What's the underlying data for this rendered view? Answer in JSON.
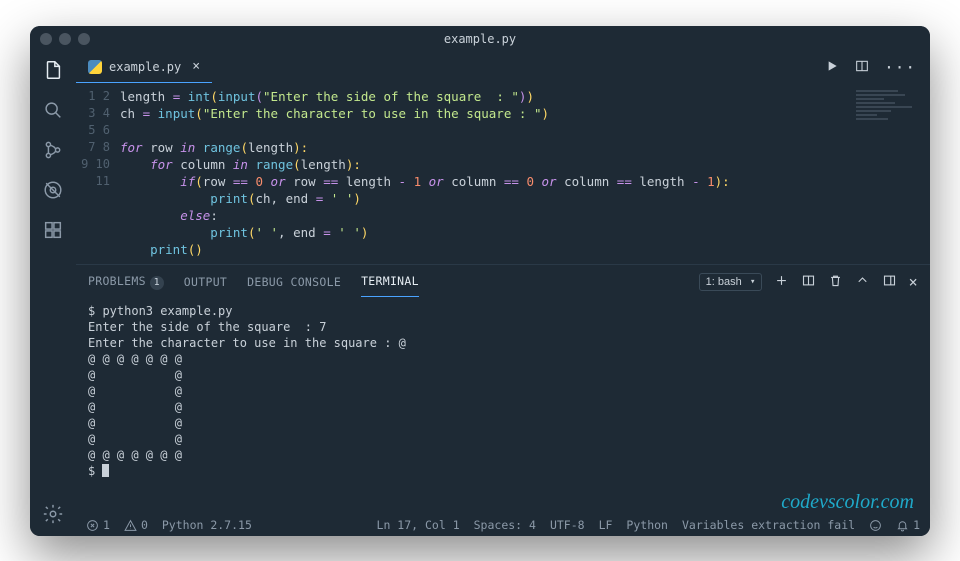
{
  "window": {
    "title": "example.py"
  },
  "tabs": [
    {
      "label": "example.py"
    }
  ],
  "code": {
    "line_numbers": [
      "1",
      "2",
      "3",
      "4",
      "5",
      "6",
      "7",
      "8",
      "9",
      "10",
      "11"
    ],
    "l1_a": "length ",
    "l1_b": "= ",
    "l1_c": "int",
    "l1_d": "(",
    "l1_e": "input",
    "l1_f": "(",
    "l1_g": "\"Enter the side of the square  : \"",
    "l1_h": ")",
    "l1_i": ")",
    "l2_a": "ch ",
    "l2_b": "= ",
    "l2_c": "input",
    "l2_d": "(",
    "l2_e": "\"Enter the character to use in the square : \"",
    "l2_f": ")",
    "l4_a": "for ",
    "l4_b": "row ",
    "l4_c": "in ",
    "l4_d": "range",
    "l4_e": "(",
    "l4_f": "length",
    "l4_g": "):",
    "l5_a": "    for ",
    "l5_b": "column ",
    "l5_c": "in ",
    "l5_d": "range",
    "l5_e": "(",
    "l5_f": "length",
    "l5_g": "):",
    "l6_a": "        if",
    "l6_b": "(",
    "l6_c": "row ",
    "l6_d": "== ",
    "l6_e": "0",
    "l6_f": " or ",
    "l6_g": "row ",
    "l6_h": "== ",
    "l6_i": "length ",
    "l6_j": "- ",
    "l6_k": "1",
    "l6_l": " or ",
    "l6_m": "column ",
    "l6_n": "== ",
    "l6_o": "0",
    "l6_p": " or ",
    "l6_q": "column ",
    "l6_r": "== ",
    "l6_s": "length ",
    "l6_t": "- ",
    "l6_u": "1",
    "l6_v": "):",
    "l7_a": "            print",
    "l7_b": "(",
    "l7_c": "ch",
    "l7_d": ", ",
    "l7_e": "end ",
    "l7_f": "= ",
    "l7_g": "' '",
    "l7_h": ")",
    "l8_a": "        else",
    "l8_b": ":",
    "l9_a": "            print",
    "l9_b": "(",
    "l9_c": "' '",
    "l9_d": ", ",
    "l9_e": "end ",
    "l9_f": "= ",
    "l9_g": "' '",
    "l9_h": ")",
    "l10_a": "    print",
    "l10_b": "()"
  },
  "panel": {
    "tabs": {
      "problems": "PROBLEMS",
      "problems_badge": "1",
      "output": "OUTPUT",
      "debug": "DEBUG CONSOLE",
      "terminal": "TERMINAL"
    },
    "terminal_selector": "1: bash"
  },
  "terminal": {
    "lines": [
      "$ python3 example.py",
      "Enter the side of the square  : 7",
      "Enter the character to use in the square : @",
      "@ @ @ @ @ @ @ ",
      "@           @ ",
      "@           @ ",
      "@           @ ",
      "@           @ ",
      "@           @ ",
      "@ @ @ @ @ @ @ ",
      "$ "
    ]
  },
  "watermark": "codevscolor.com",
  "statusbar": {
    "errors": "1",
    "warnings": "0",
    "python": "Python 2.7.15",
    "position": "Ln 17, Col 1",
    "spaces": "Spaces: 4",
    "encoding": "UTF-8",
    "eol": "LF",
    "language": "Python",
    "lint": "Variables extraction fail",
    "bell": "1"
  }
}
